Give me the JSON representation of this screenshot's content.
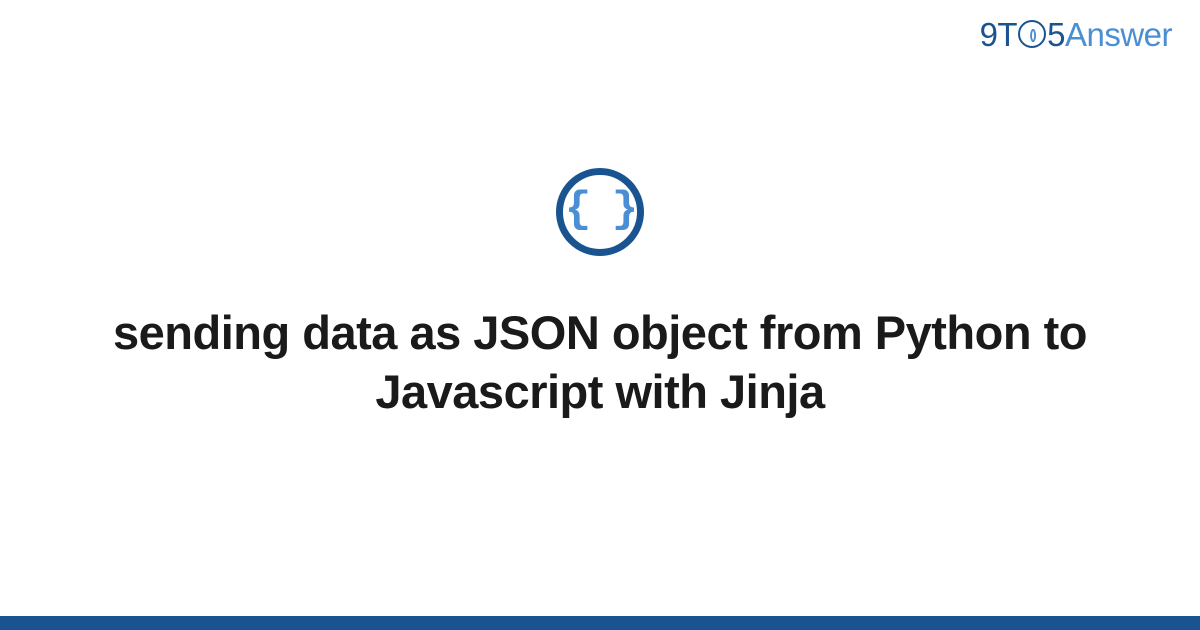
{
  "header": {
    "logo_part1": "9T",
    "logo_circle_content": "()",
    "logo_part2": "5",
    "logo_part3": "Answer"
  },
  "icon": {
    "braces": "{ }"
  },
  "main": {
    "title": "sending data as JSON object from Python to Javascript with Jinja"
  },
  "colors": {
    "primary_dark": "#1a5490",
    "primary_light": "#4a8fd4",
    "text": "#1a1a1a",
    "background": "#ffffff"
  }
}
